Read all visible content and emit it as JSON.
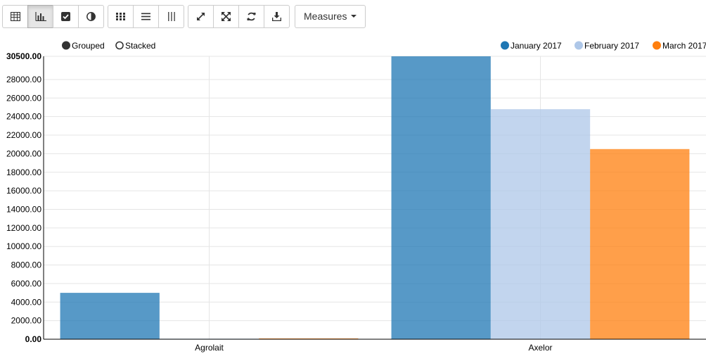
{
  "toolbar": {
    "view_buttons": [
      {
        "icon": "table-icon",
        "active": false
      },
      {
        "icon": "bar-chart-icon",
        "active": true
      },
      {
        "icon": "checkbox-icon",
        "active": false
      },
      {
        "icon": "contrast-icon",
        "active": false
      }
    ],
    "layout_buttons": [
      {
        "icon": "grid-icon"
      },
      {
        "icon": "list-icon"
      },
      {
        "icon": "columns-icon"
      }
    ],
    "action_buttons": [
      {
        "icon": "expand-icon"
      },
      {
        "icon": "fullscreen-icon"
      },
      {
        "icon": "refresh-icon"
      },
      {
        "icon": "download-icon"
      }
    ],
    "measures_label": "Measures"
  },
  "mode_toggle": {
    "grouped_label": "Grouped",
    "stacked_label": "Stacked",
    "selected": "grouped"
  },
  "chart_data": {
    "type": "bar",
    "categories": [
      "Agrolait",
      "Axelor"
    ],
    "series": [
      {
        "name": "January 2017",
        "color": "#1f77b4",
        "values": [
          5000,
          30500
        ]
      },
      {
        "name": "February 2017",
        "color": "#aec7e8",
        "values": [
          60,
          24800
        ]
      },
      {
        "name": "March 2017",
        "color": "#ff7f0e",
        "values": [
          90,
          20500
        ]
      }
    ],
    "ylim": [
      0,
      30500
    ],
    "yticks": [
      "0.00",
      "2000.00",
      "4000.00",
      "6000.00",
      "8000.00",
      "10000.00",
      "12000.00",
      "14000.00",
      "16000.00",
      "18000.00",
      "20000.00",
      "22000.00",
      "24000.00",
      "26000.00",
      "28000.00",
      "30500.00"
    ],
    "ytick_values": [
      0,
      2000,
      4000,
      6000,
      8000,
      10000,
      12000,
      14000,
      16000,
      18000,
      20000,
      22000,
      24000,
      26000,
      28000,
      30500
    ],
    "grid": true,
    "legend_position": "top-right",
    "bar_opacity": 0.75
  }
}
